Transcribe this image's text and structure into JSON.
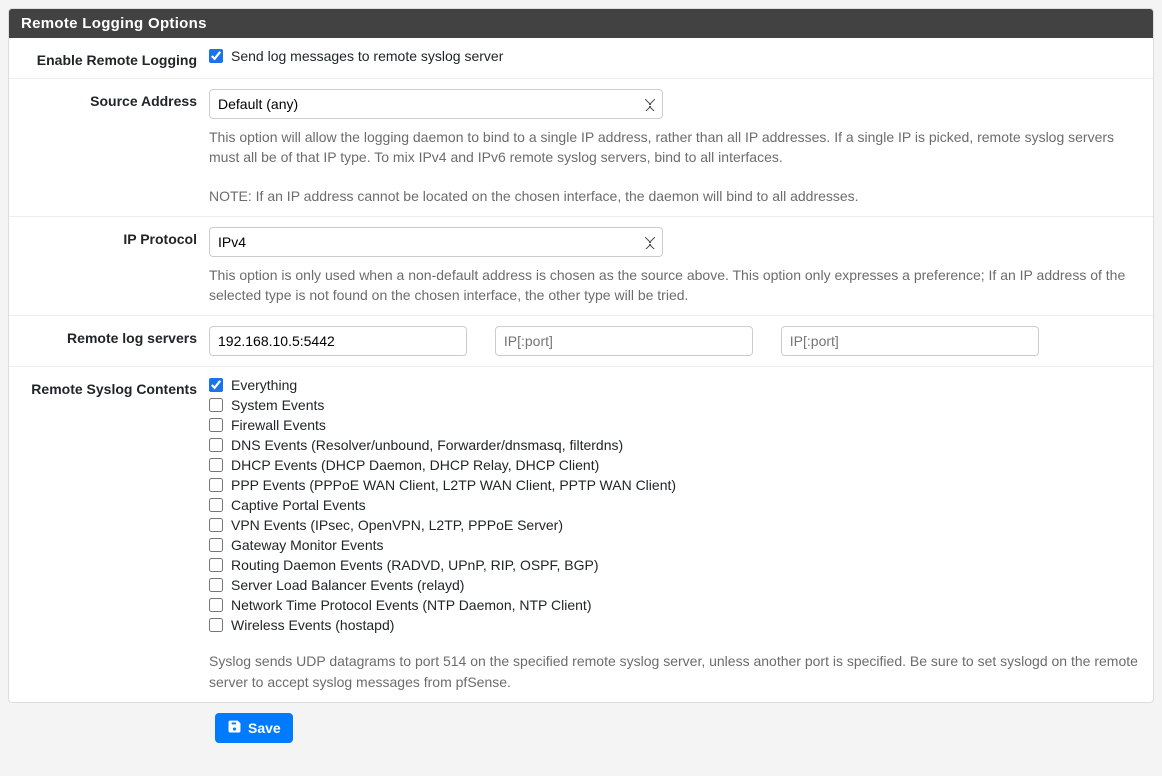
{
  "panel": {
    "title": "Remote Logging Options"
  },
  "enable": {
    "label": "Enable Remote Logging",
    "text": "Send log messages to remote syslog server",
    "checked": true
  },
  "source": {
    "label": "Source Address",
    "value": "Default (any)",
    "help1": "This option will allow the logging daemon to bind to a single IP address, rather than all IP addresses. If a single IP is picked, remote syslog servers must all be of that IP type. To mix IPv4 and IPv6 remote syslog servers, bind to all interfaces.",
    "help2": "NOTE: If an IP address cannot be located on the chosen interface, the daemon will bind to all addresses."
  },
  "ipproto": {
    "label": "IP Protocol",
    "value": "IPv4",
    "help": "This option is only used when a non-default address is chosen as the source above. This option only expresses a preference; If an IP address of the selected type is not found on the chosen interface, the other type will be tried."
  },
  "servers": {
    "label": "Remote log servers",
    "s1": "192.168.10.5:5442",
    "s2": "",
    "s3": "",
    "placeholder": "IP[:port]"
  },
  "contents": {
    "label": "Remote Syslog Contents",
    "items": [
      {
        "label": "Everything",
        "checked": true
      },
      {
        "label": "System Events",
        "checked": false
      },
      {
        "label": "Firewall Events",
        "checked": false
      },
      {
        "label": "DNS Events (Resolver/unbound, Forwarder/dnsmasq, filterdns)",
        "checked": false
      },
      {
        "label": "DHCP Events (DHCP Daemon, DHCP Relay, DHCP Client)",
        "checked": false
      },
      {
        "label": "PPP Events (PPPoE WAN Client, L2TP WAN Client, PPTP WAN Client)",
        "checked": false
      },
      {
        "label": "Captive Portal Events",
        "checked": false
      },
      {
        "label": "VPN Events (IPsec, OpenVPN, L2TP, PPPoE Server)",
        "checked": false
      },
      {
        "label": "Gateway Monitor Events",
        "checked": false
      },
      {
        "label": "Routing Daemon Events (RADVD, UPnP, RIP, OSPF, BGP)",
        "checked": false
      },
      {
        "label": "Server Load Balancer Events (relayd)",
        "checked": false
      },
      {
        "label": "Network Time Protocol Events (NTP Daemon, NTP Client)",
        "checked": false
      },
      {
        "label": "Wireless Events (hostapd)",
        "checked": false
      }
    ],
    "help": "Syslog sends UDP datagrams to port 514 on the specified remote syslog server, unless another port is specified. Be sure to set syslogd on the remote server to accept syslog messages from pfSense."
  },
  "save": {
    "label": "Save"
  }
}
